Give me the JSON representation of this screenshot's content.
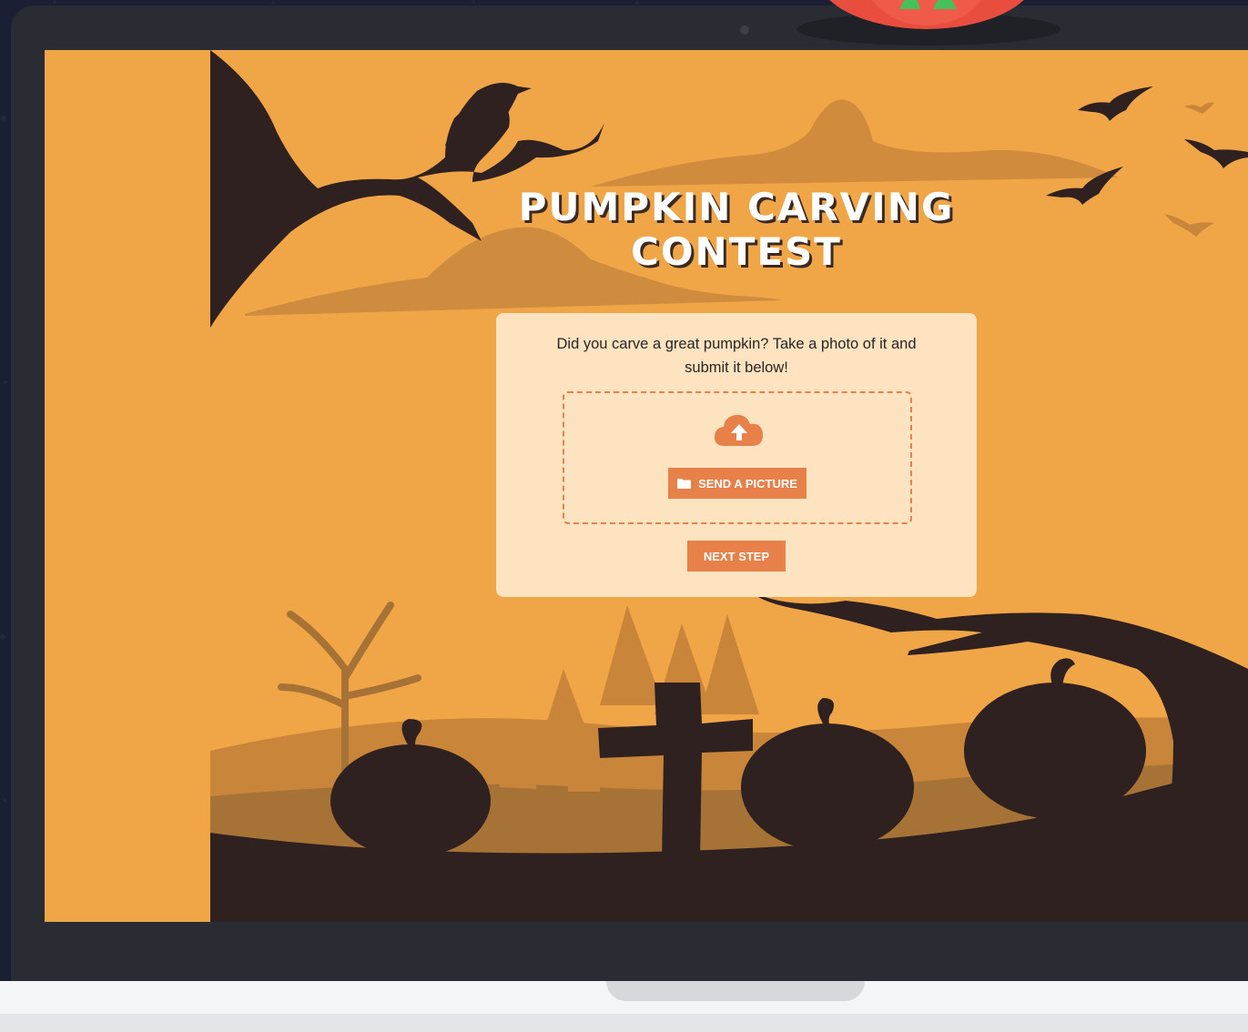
{
  "page": {
    "title": "PUMPKIN CARVING CONTEST",
    "intro_text": "Did you carve a great pumpkin? Take a photo of it and submit it below!"
  },
  "upload": {
    "icon": "cloud-upload-icon",
    "send_button_icon": "folder-icon",
    "send_button_label": "SEND A PICTURE"
  },
  "actions": {
    "next_label": "NEXT STEP"
  },
  "colors": {
    "screen_background": "#f0a547",
    "silhouette": "#2e211f",
    "hill_mid": "#c98539",
    "hill_dark": "#a77236",
    "card_background": "#fee3c0",
    "accent_button": "#e8804a",
    "laptop_frame": "#2a2c33",
    "page_background": "#1b1f33"
  }
}
